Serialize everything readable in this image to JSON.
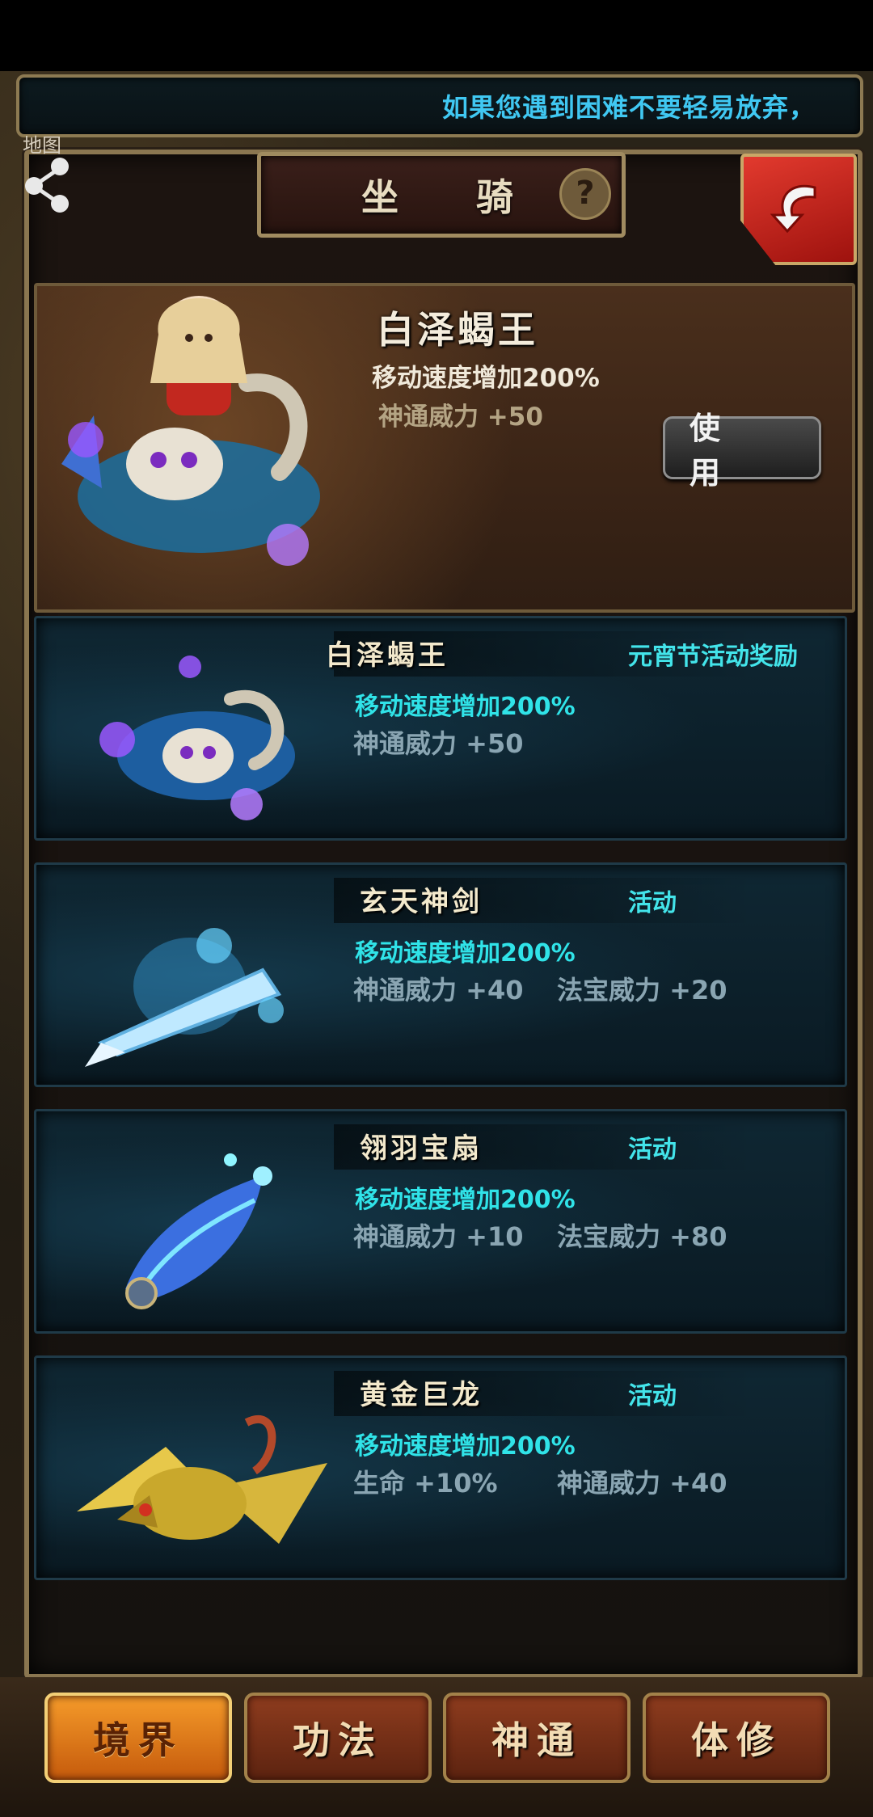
{
  "ticker": {
    "text": "如果您遇到困难不要轻易放弃，"
  },
  "header": {
    "title": "坐 骑",
    "help_label": "?",
    "map_label": "地图",
    "share_icon": "share-icon",
    "back_icon": "back-arrow-icon"
  },
  "featured": {
    "name": "白泽蝎王",
    "speed": "移动速度增加200%",
    "power": "神通威力 +50",
    "use_label": "使 用"
  },
  "mounts": [
    {
      "name": "白泽蝎王",
      "tag": "元宵节活动奖励",
      "speed": "移动速度增加200%",
      "stat1": "神通威力 +50",
      "stat2": ""
    },
    {
      "name": "玄天神剑",
      "tag": "活动",
      "speed": "移动速度增加200%",
      "stat1": "神通威力 +40",
      "stat2": "法宝威力 +20"
    },
    {
      "name": "翎羽宝扇",
      "tag": "活动",
      "speed": "移动速度增加200%",
      "stat1": "神通威力 +10",
      "stat2": "法宝威力 +80"
    },
    {
      "name": "黄金巨龙",
      "tag": "活动",
      "speed": "移动速度增加200%",
      "stat1": "生命 +10%",
      "stat2": "神通威力 +40"
    }
  ],
  "tabs": [
    {
      "label": "境界",
      "active": true
    },
    {
      "label": "功法",
      "active": false
    },
    {
      "label": "神通",
      "active": false
    },
    {
      "label": "体修",
      "active": false
    }
  ],
  "colors": {
    "accent_cyan": "#30e3e8",
    "active_tab": "#f59b2a",
    "back_red": "#e23a2e"
  }
}
